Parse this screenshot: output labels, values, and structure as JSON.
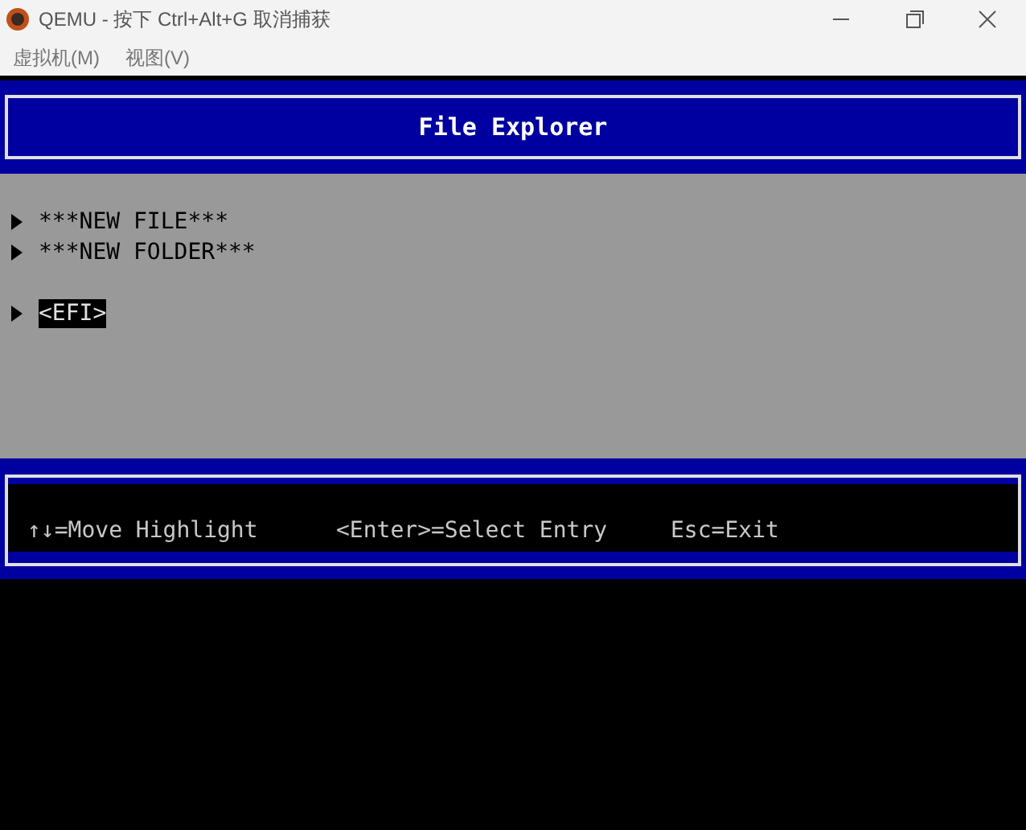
{
  "window": {
    "title": "QEMU - 按下 Ctrl+Alt+G 取消捕获"
  },
  "menu": [
    "虚拟机(M)",
    "视图(V)"
  ],
  "header": {
    "title": "File Explorer"
  },
  "entries": [
    {
      "label": "***NEW FILE***",
      "selected": false
    },
    {
      "label": "***NEW FOLDER***",
      "selected": false
    },
    {
      "label": "<EFI>",
      "selected": true
    }
  ],
  "help": [
    "↑↓=Move Highlight",
    "<Enter>=Select Entry",
    "Esc=Exit"
  ]
}
